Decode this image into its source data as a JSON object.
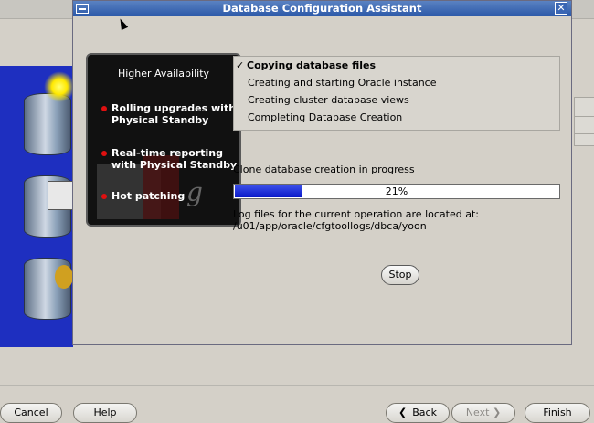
{
  "dialog": {
    "title": "Database Configuration Assistant",
    "close_glyph": "✕"
  },
  "promo": {
    "title": "Higher Availability",
    "items": [
      "Rolling upgrades with Physical Standby",
      "Real-time reporting with Physical Standby",
      "Hot patching"
    ],
    "logo_mark": "g"
  },
  "steps": [
    {
      "label": "Copying database files",
      "active": true
    },
    {
      "label": "Creating and starting Oracle instance",
      "active": false
    },
    {
      "label": "Creating cluster database views",
      "active": false
    },
    {
      "label": "Completing Database Creation",
      "active": false
    }
  ],
  "check_glyph": "✓",
  "status_text": "Clone database creation in progress",
  "progress": {
    "value": 21,
    "label": "21%",
    "color": "#0818c8"
  },
  "log": {
    "line1": "Log files for the current operation are located at:",
    "line2": "/u01/app/oracle/cfgtoollogs/dbca/yoon"
  },
  "stop_label": "Stop",
  "wizard_buttons": {
    "cancel": "Cancel",
    "help": "Help",
    "back": "Back",
    "next": "Next",
    "finish": "Finish",
    "back_arrow": "❮",
    "next_arrow": "❯"
  },
  "colors": {
    "titlebar": "#2b58a8",
    "bullet": "#e01010"
  }
}
